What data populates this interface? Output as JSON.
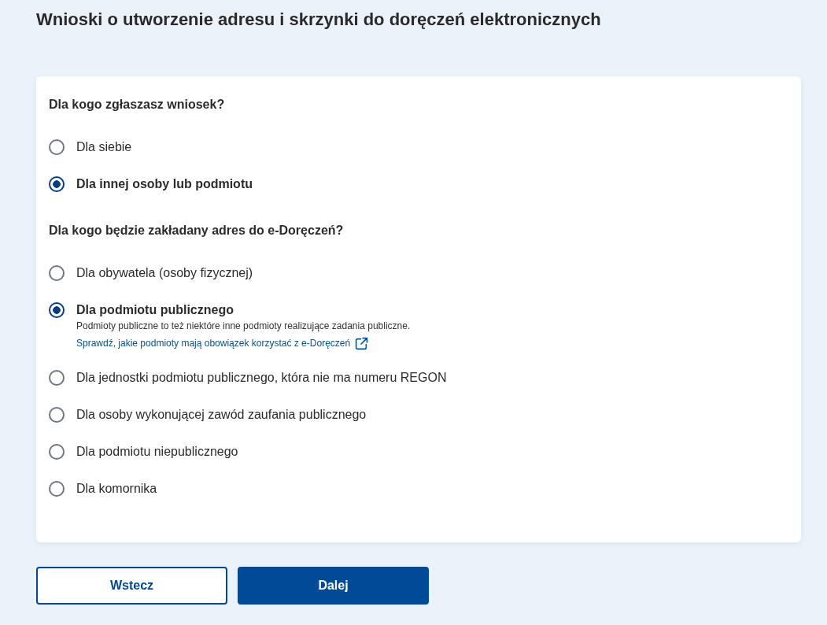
{
  "page": {
    "title": "Wnioski o utworzenie adresu i skrzynki do doręczeń elektronicznych"
  },
  "questions": [
    {
      "label": "Dla kogo zgłaszasz wniosek?",
      "options": [
        {
          "label": "Dla siebie",
          "selected": false
        },
        {
          "label": "Dla innej osoby lub podmiotu",
          "selected": true
        }
      ]
    },
    {
      "label": "Dla kogo będzie zakładany adres do e-Doręczeń?",
      "options": [
        {
          "label": "Dla obywatela (osoby fizycznej)",
          "selected": false
        },
        {
          "label": "Dla podmiotu publicznego",
          "selected": true,
          "description": "Podmioty publiczne to też niektóre inne podmioty realizujące zadania publiczne.",
          "link": "Sprawdź, jakie podmioty mają obowiązek korzystać z e-Doręczeń"
        },
        {
          "label": "Dla jednostki podmiotu publicznego, która nie ma numeru REGON",
          "selected": false
        },
        {
          "label": "Dla osoby wykonującej zawód zaufania publicznego",
          "selected": false
        },
        {
          "label": "Dla podmiotu niepublicznego",
          "selected": false
        },
        {
          "label": "Dla komornika",
          "selected": false
        }
      ]
    }
  ],
  "buttons": [
    {
      "label": "Wstecz",
      "kind": "secondary"
    },
    {
      "label": "Dalej",
      "kind": "primary"
    }
  ]
}
